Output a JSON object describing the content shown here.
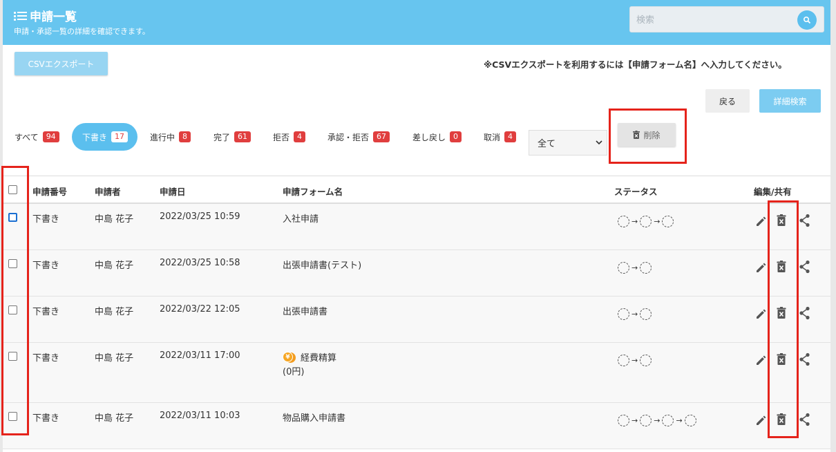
{
  "header": {
    "title": "申請一覧",
    "subtitle": "申請・承認一覧の詳細を確認できます。",
    "search_placeholder": "検索",
    "bg_color": "#67c5ef"
  },
  "toolbar": {
    "csv_label": "CSVエクスポート",
    "csv_note": "※CSVエクスポートを利用するには【申請フォーム名】へ入力してください。",
    "back_label": "戻る",
    "advanced_search_label": "詳細検索",
    "delete_label": "削除"
  },
  "tabs": [
    {
      "label": "すべて",
      "count": "94"
    },
    {
      "label": "下書き",
      "count": "17",
      "active": true
    },
    {
      "label": "進行中",
      "count": "8"
    },
    {
      "label": "完了",
      "count": "61"
    },
    {
      "label": "拒否",
      "count": "4"
    },
    {
      "label": "承認・拒否",
      "count": "67"
    },
    {
      "label": "差し戻し",
      "count": "0"
    },
    {
      "label": "取消",
      "count": "4"
    }
  ],
  "filter_select": {
    "value": "全て"
  },
  "table": {
    "headers": [
      "申請番号",
      "申請者",
      "申請日",
      "申請フォーム名",
      "ステータス",
      "編集/共有"
    ],
    "rows": [
      {
        "number": "下書き",
        "applicant": "中島 花子",
        "date": "2022/03/25 10:59",
        "form": "入社申請",
        "form_sub": "",
        "steps": 3
      },
      {
        "number": "下書き",
        "applicant": "中島 花子",
        "date": "2022/03/25 10:58",
        "form": "出張申請書(テスト)",
        "form_sub": "",
        "steps": 2
      },
      {
        "number": "下書き",
        "applicant": "中島 花子",
        "date": "2022/03/22 12:05",
        "form": "出張申請書",
        "form_sub": "",
        "steps": 2
      },
      {
        "number": "下書き",
        "applicant": "中島 花子",
        "date": "2022/03/11 17:00",
        "form": "経費精算",
        "form_sub": "(0円)",
        "steps": 2,
        "yen_icon": true
      },
      {
        "number": "下書き",
        "applicant": "中島 花子",
        "date": "2022/03/11 10:03",
        "form": "物品購入申請書",
        "form_sub": "",
        "steps": 4
      }
    ]
  },
  "colors": {
    "accent": "#5bbfee",
    "badge": "#e03e3e",
    "highlight": "#e5231b",
    "icon": "#555555"
  }
}
